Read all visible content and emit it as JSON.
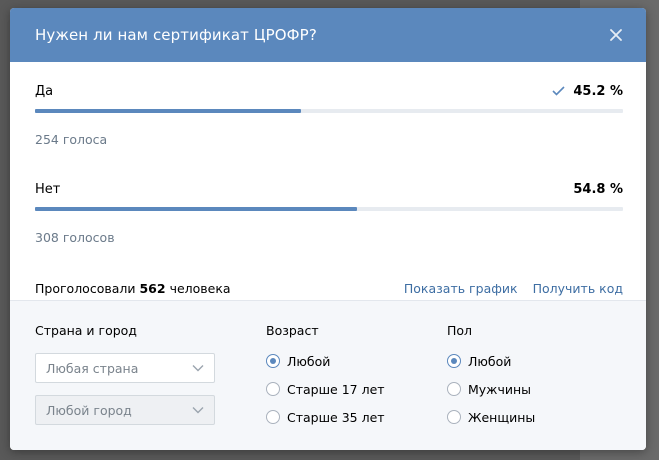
{
  "modal": {
    "title": "Нужен ли нам сертификат ЦРОФР?",
    "close_icon": "close-icon"
  },
  "options": [
    {
      "label": "Да",
      "percent": "45.2 %",
      "fraction": 0.452,
      "votes": "254 голоса",
      "checked": true
    },
    {
      "label": "Нет",
      "percent": "54.8 %",
      "fraction": 0.548,
      "votes": "308 голосов",
      "checked": false
    }
  ],
  "totals": {
    "prefix": "Проголосовали",
    "count": "562",
    "suffix": "человека"
  },
  "links": {
    "show_chart": "Показать график",
    "get_code": "Получить код"
  },
  "filters": {
    "location": {
      "title": "Страна и город",
      "country_placeholder": "Любая страна",
      "city_placeholder": "Любой город"
    },
    "age": {
      "title": "Возраст",
      "options": [
        "Любой",
        "Старше 17 лет",
        "Старше 35 лет"
      ],
      "selected": 0
    },
    "gender": {
      "title": "Пол",
      "options": [
        "Любой",
        "Мужчины",
        "Женщины"
      ],
      "selected": 0
    }
  },
  "colors": {
    "accent": "#5b88bd",
    "link": "#3e6ea3",
    "bar_track": "#e7ebf0"
  }
}
